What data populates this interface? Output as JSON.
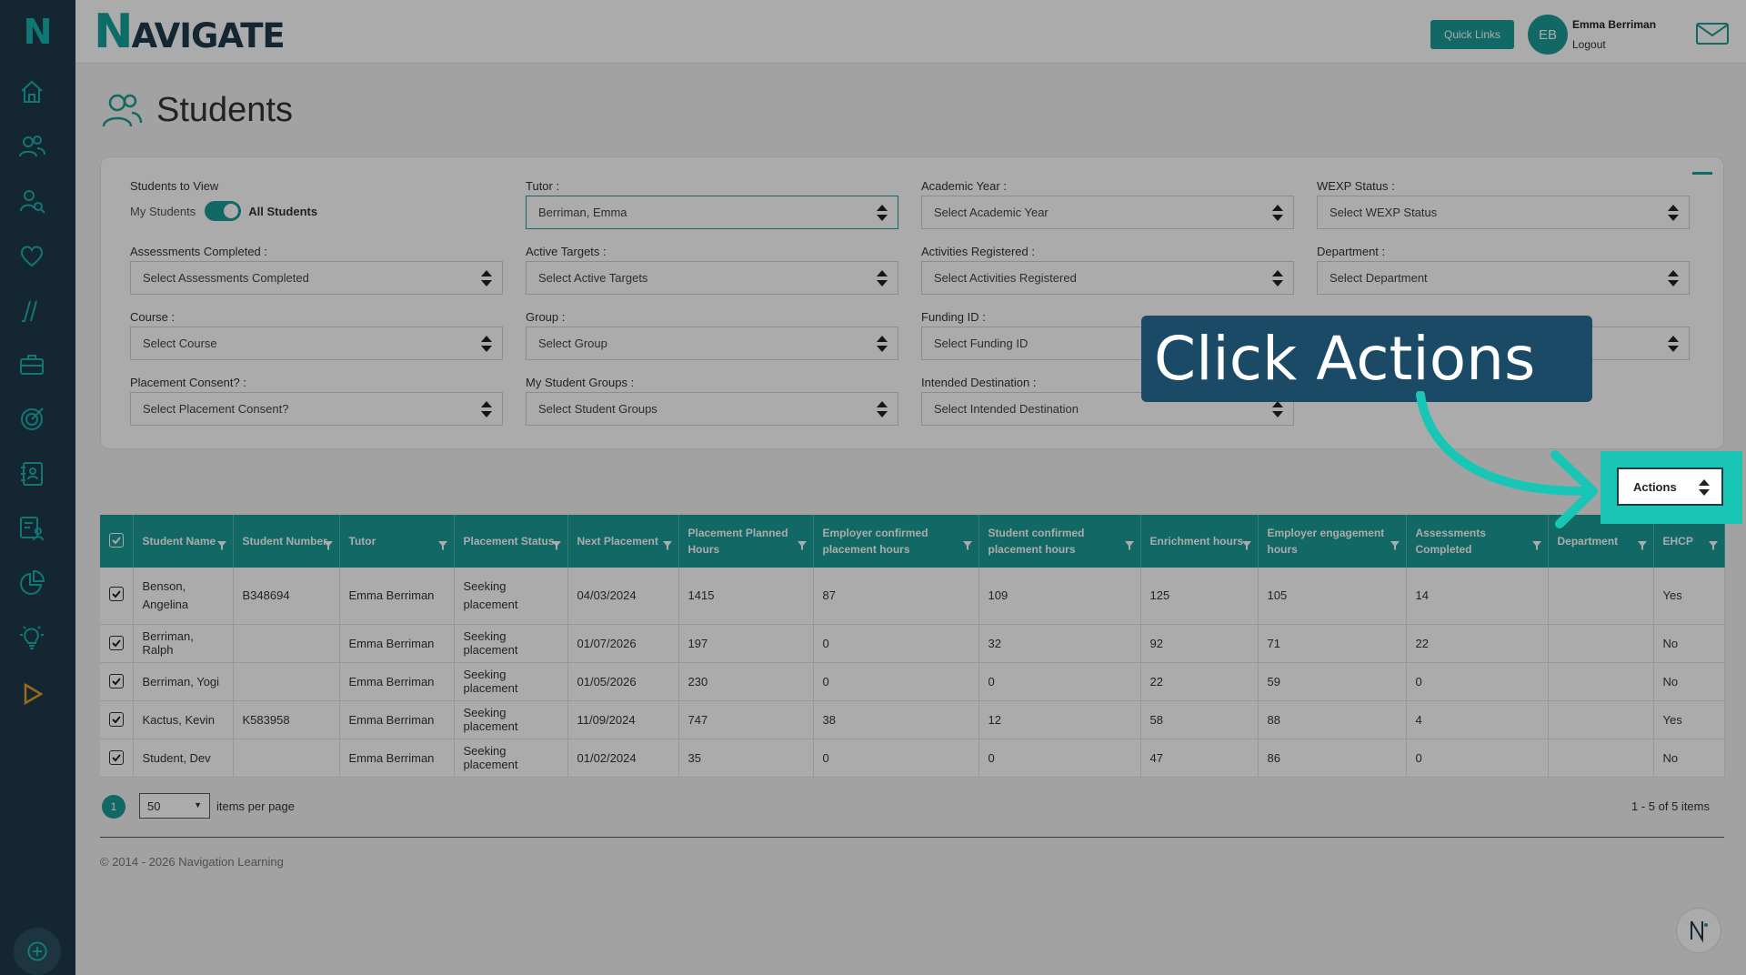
{
  "app": {
    "brand_first": "N",
    "brand_rest": "AVIGATE",
    "sidebar_logo": "N"
  },
  "header": {
    "quick_links": "Quick Links",
    "avatar_initials": "EB",
    "user_name": "Emma Berriman",
    "logout": "Logout"
  },
  "page": {
    "title": "Students"
  },
  "filters": {
    "students_to_view": {
      "label": "Students to View",
      "off_label": "My Students",
      "on_label": "All Students"
    },
    "tutor": {
      "label": "Tutor :",
      "value": "Berriman, Emma"
    },
    "academic_year": {
      "label": "Academic Year :",
      "value": "Select Academic Year"
    },
    "wexp_status": {
      "label": "WEXP Status :",
      "value": "Select WEXP Status"
    },
    "assessments_completed": {
      "label": "Assessments Completed :",
      "value": "Select Assessments Completed"
    },
    "active_targets": {
      "label": "Active Targets :",
      "value": "Select Active Targets"
    },
    "activities_registered": {
      "label": "Activities Registered :",
      "value": "Select Activities Registered"
    },
    "department": {
      "label": "Department :",
      "value": "Select Department"
    },
    "course": {
      "label": "Course :",
      "value": "Select Course"
    },
    "group": {
      "label": "Group :",
      "value": "Select Group"
    },
    "funding_id": {
      "label": "Funding ID :",
      "value": "Select Funding ID"
    },
    "placement_consent": {
      "label": "Placement Consent? :",
      "value": "Select Placement Consent?"
    },
    "student_groups": {
      "label": "My Student Groups :",
      "value": "Select Student Groups"
    },
    "intended_destination": {
      "label": "Intended Destination :",
      "value": "Select Intended Destination"
    }
  },
  "actions": {
    "label": "Actions"
  },
  "callout": {
    "text": "Click Actions"
  },
  "table": {
    "columns": [
      "Student Name",
      "Student Number",
      "Tutor",
      "Placement Status",
      "Next Placement",
      "Placement Planned Hours",
      "Employer confirmed placement hours",
      "Student confirmed placement hours",
      "Enrichment hours",
      "Employer engagement hours",
      "Assessments Completed",
      "Department",
      "EHCP"
    ],
    "rows": [
      [
        "Benson, Angelina",
        "B348694",
        "Emma Berriman",
        "Seeking placement",
        "04/03/2024",
        "1415",
        "87",
        "109",
        "125",
        "105",
        "14",
        "",
        "Yes"
      ],
      [
        "Berriman, Ralph",
        "",
        "Emma Berriman",
        "Seeking placement",
        "01/07/2026",
        "197",
        "0",
        "32",
        "92",
        "71",
        "22",
        "",
        "No"
      ],
      [
        "Berriman, Yogi",
        "",
        "Emma Berriman",
        "Seeking placement",
        "01/05/2026",
        "230",
        "0",
        "0",
        "22",
        "59",
        "0",
        "",
        "No"
      ],
      [
        "Kactus, Kevin",
        "K583958",
        "Emma Berriman",
        "Seeking placement",
        "11/09/2024",
        "747",
        "38",
        "12",
        "58",
        "88",
        "4",
        "",
        "Yes"
      ],
      [
        "Student, Dev",
        "",
        "Emma Berriman",
        "Seeking placement",
        "01/02/2024",
        "35",
        "0",
        "0",
        "47",
        "86",
        "0",
        "",
        "No"
      ]
    ]
  },
  "pager": {
    "current_page": "1",
    "per_page": "50",
    "items_per_page": "items per page",
    "count": "1 - 5 of 5 items"
  },
  "footer": {
    "copyright": "© 2014 - 2026 Navigation Learning"
  },
  "colors": {
    "teal": "#1a9b95",
    "sidebar": "#1f3a4b",
    "callout": "#1b4a66",
    "highlight": "#19c6b6"
  }
}
